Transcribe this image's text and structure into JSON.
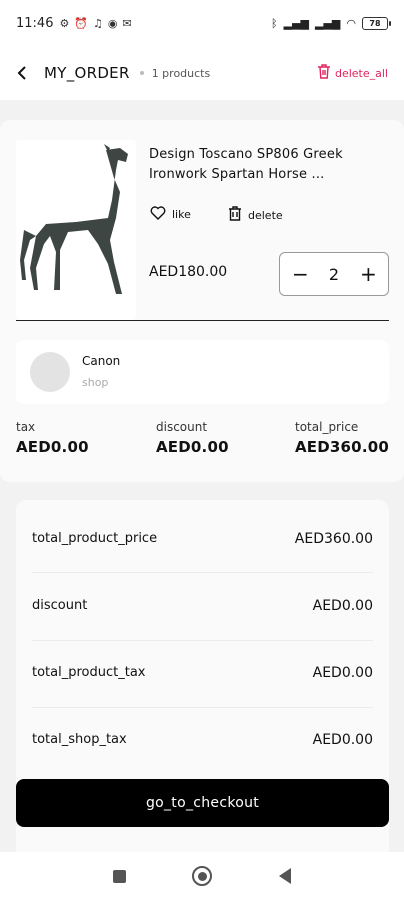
{
  "status": {
    "time": "11:46",
    "battery": "78"
  },
  "header": {
    "title": "MY_ORDER",
    "count": "1 products",
    "delete_all": "delete_all"
  },
  "product": {
    "name": "Design Toscano SP806 Greek Ironwork Spartan Horse ...",
    "like": "like",
    "delete": "delete",
    "price": "AED180.00",
    "quantity": "2"
  },
  "shop": {
    "name": "Canon",
    "subtitle": "shop"
  },
  "totals": {
    "tax_label": "tax",
    "tax_value": "AED0.00",
    "discount_label": "discount",
    "discount_value": "AED0.00",
    "total_label": "total_price",
    "total_value": "AED360.00"
  },
  "summary": [
    {
      "label": "total_product_price",
      "value": "AED360.00"
    },
    {
      "label": "discount",
      "value": "AED0.00"
    },
    {
      "label": "total_product_tax",
      "value": "AED0.00"
    },
    {
      "label": "total_shop_tax",
      "value": "AED0.00"
    }
  ],
  "checkout_label": "go_to_checkout",
  "accent_color": "#e0245e"
}
